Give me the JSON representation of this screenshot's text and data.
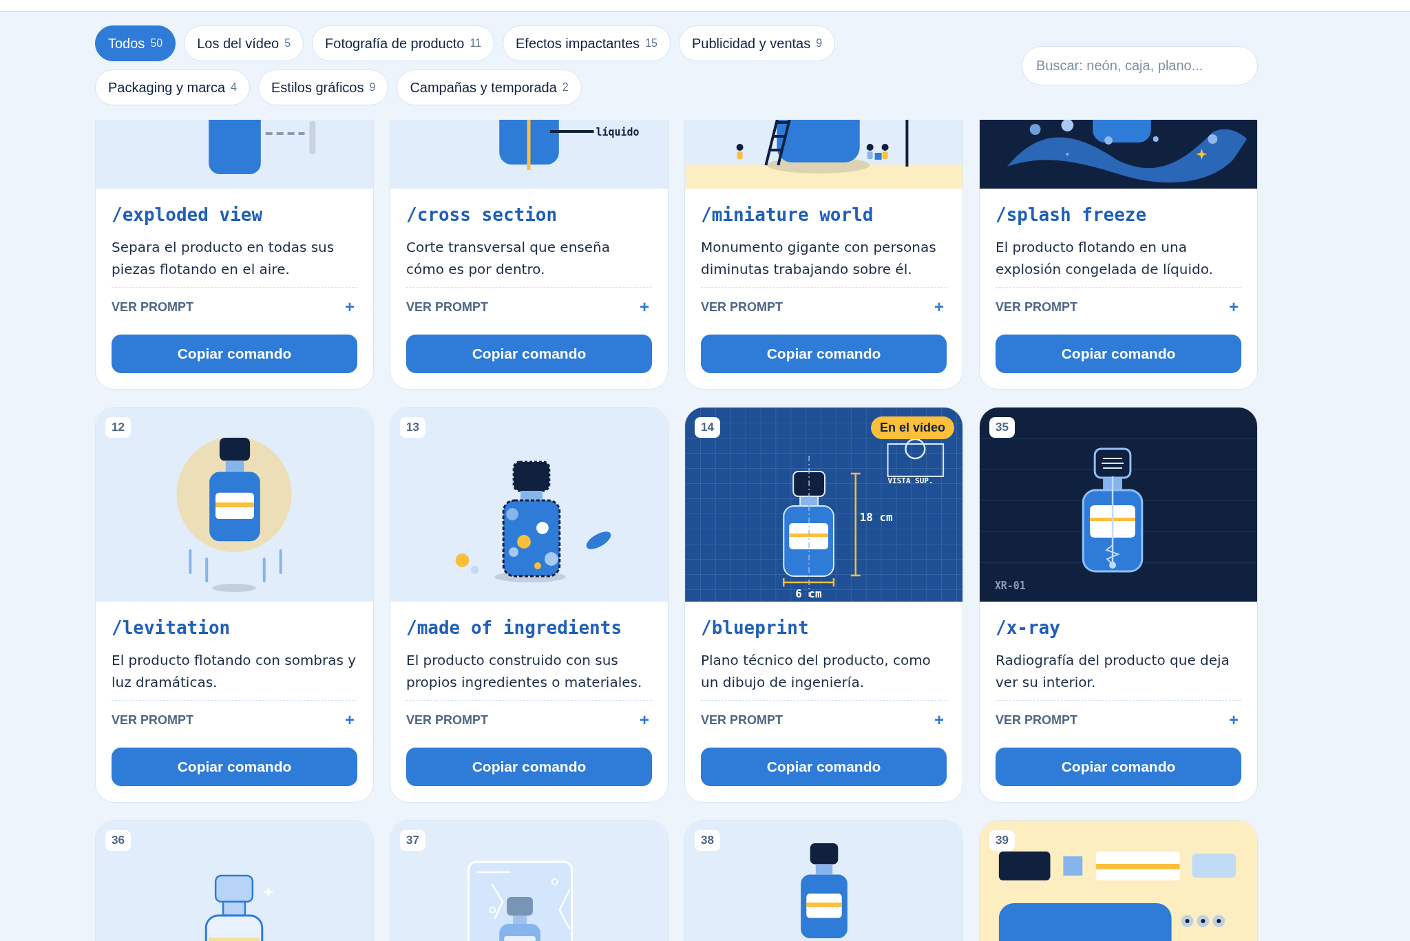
{
  "filters": [
    {
      "label": "Todos",
      "count": "50",
      "selected": true
    },
    {
      "label": "Los del vídeo",
      "count": "5",
      "selected": false
    },
    {
      "label": "Fotografía de producto",
      "count": "11",
      "selected": false
    },
    {
      "label": "Efectos impactantes",
      "count": "15",
      "selected": false
    },
    {
      "label": "Publicidad y ventas",
      "count": "9",
      "selected": false
    },
    {
      "label": "Packaging y marca",
      "count": "4",
      "selected": false
    },
    {
      "label": "Estilos gráficos",
      "count": "9",
      "selected": false
    },
    {
      "label": "Campañas y temporada",
      "count": "2",
      "selected": false
    }
  ],
  "search": {
    "placeholder": "Buscar: neón, caja, plano..."
  },
  "cards": [
    {
      "title": "/exploded view",
      "description": "Separa el producto en todas sus piezas flotando en el aire.",
      "prompt_toggle": "VER PROMPT",
      "expand_icon": "+",
      "button": "Copiar comando",
      "illustration": {
        "kind": "exploded"
      }
    },
    {
      "title": "/cross section",
      "description": "Corte transversal que enseña cómo es por dentro.",
      "prompt_toggle": "VER PROMPT",
      "expand_icon": "+",
      "button": "Copiar comando",
      "illustration": {
        "kind": "cross_section",
        "labels": [
          "líquido"
        ]
      }
    },
    {
      "title": "/miniature world",
      "description": "Monumento gigante con personas diminutas trabajando sobre él.",
      "prompt_toggle": "VER PROMPT",
      "expand_icon": "+",
      "button": "Copiar comando",
      "illustration": {
        "kind": "miniature"
      }
    },
    {
      "title": "/splash freeze",
      "description": "El producto flotando en una explosión congelada de líquido.",
      "prompt_toggle": "VER PROMPT",
      "expand_icon": "+",
      "button": "Copiar comando",
      "illustration": {
        "kind": "splash"
      }
    },
    {
      "number": "12",
      "title": "/levitation",
      "description": "El producto flotando con sombras y luz dramáticas.",
      "prompt_toggle": "VER PROMPT",
      "expand_icon": "+",
      "button": "Copiar comando",
      "illustration": {
        "kind": "levitation"
      }
    },
    {
      "number": "13",
      "title": "/made of ingredients",
      "description": "El producto construido con sus propios ingredientes o materiales.",
      "prompt_toggle": "VER PROMPT",
      "expand_icon": "+",
      "button": "Copiar comando",
      "illustration": {
        "kind": "ingredients"
      }
    },
    {
      "number": "14",
      "badge": "En el vídeo",
      "title": "/blueprint",
      "description": "Plano técnico del producto, como un dibujo de ingeniería.",
      "prompt_toggle": "VER PROMPT",
      "expand_icon": "+",
      "button": "Copiar comando",
      "illustration": {
        "kind": "blueprint",
        "labels": [
          "VISTA SUP.",
          "18 cm",
          "6 cm"
        ]
      }
    },
    {
      "number": "35",
      "title": "/x-ray",
      "description": "Radiografía del producto que deja ver su interior.",
      "prompt_toggle": "VER PROMPT",
      "expand_icon": "+",
      "button": "Copiar comando",
      "illustration": {
        "kind": "xray",
        "labels": [
          "XR-01"
        ]
      }
    },
    {
      "number": "36",
      "illustration": {
        "kind": "glass"
      }
    },
    {
      "number": "37",
      "illustration": {
        "kind": "frozen"
      }
    },
    {
      "number": "38",
      "illustration": {
        "kind": "bottle"
      }
    },
    {
      "number": "39",
      "illustration": {
        "kind": "flatlay"
      }
    }
  ]
}
